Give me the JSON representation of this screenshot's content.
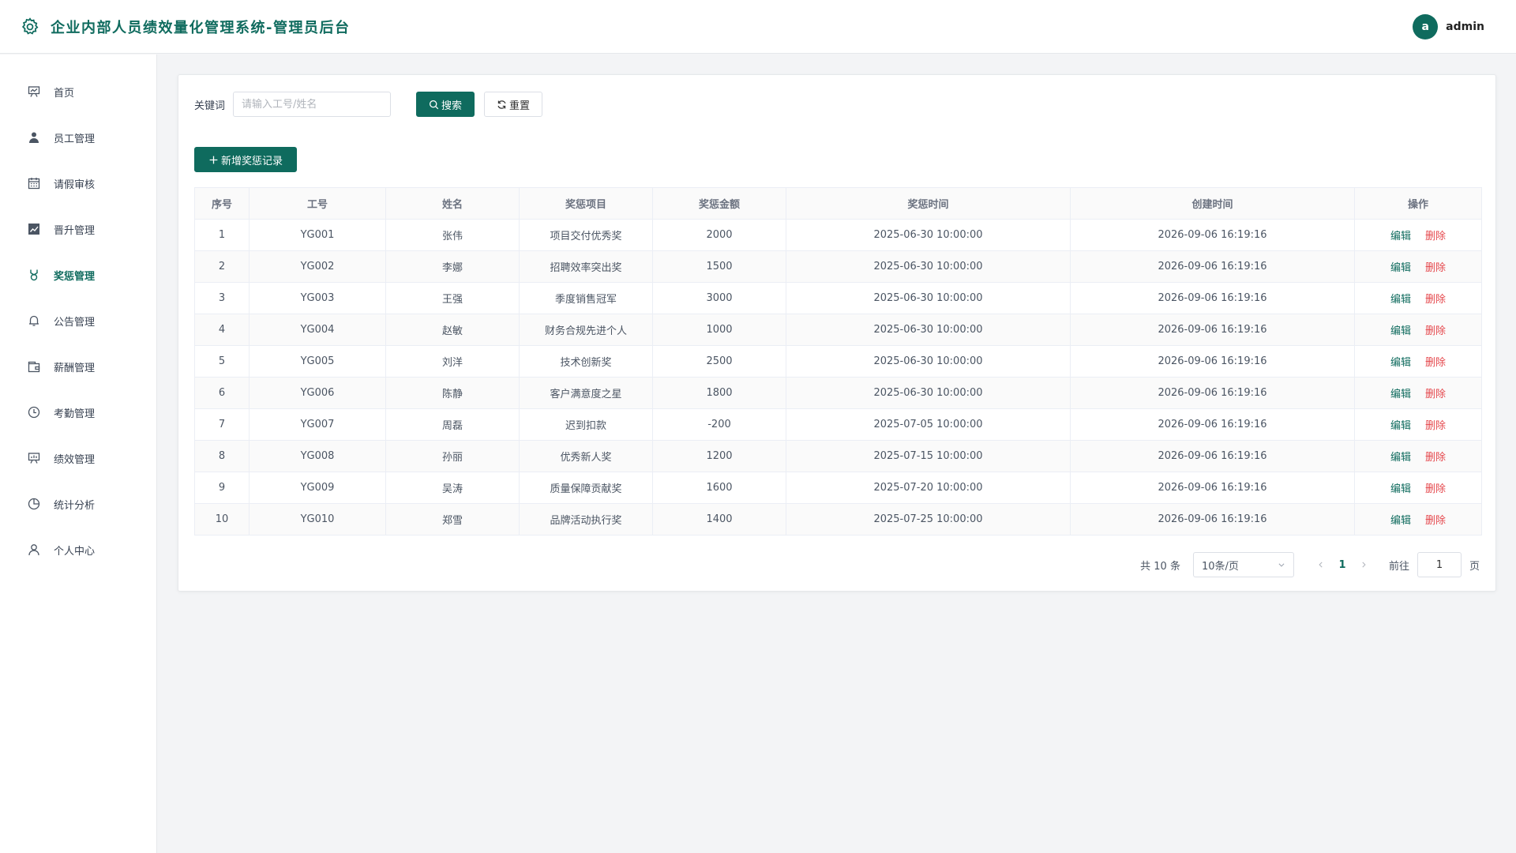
{
  "header": {
    "title": "企业内部人员绩效量化管理系统-管理员后台",
    "logo_icon": "gear-icon",
    "avatar_letter": "a",
    "username": "admin",
    "accent_color": "#0f6b5e"
  },
  "sidebar": {
    "items": [
      {
        "label": "首页",
        "icon": "presentation-icon",
        "active": false
      },
      {
        "label": "员工管理",
        "icon": "user-icon",
        "active": false
      },
      {
        "label": "请假审核",
        "icon": "calendar-icon",
        "active": false
      },
      {
        "label": "晋升管理",
        "icon": "trend-chart-icon",
        "active": false
      },
      {
        "label": "奖惩管理",
        "icon": "medal-icon",
        "active": true
      },
      {
        "label": "公告管理",
        "icon": "bell-icon",
        "active": false
      },
      {
        "label": "薪酬管理",
        "icon": "wallet-icon",
        "active": false
      },
      {
        "label": "考勤管理",
        "icon": "clock-icon",
        "active": false
      },
      {
        "label": "绩效管理",
        "icon": "data-board-icon",
        "active": false
      },
      {
        "label": "统计分析",
        "icon": "pie-chart-icon",
        "active": false
      },
      {
        "label": "个人中心",
        "icon": "user-outline-icon",
        "active": false
      }
    ]
  },
  "search": {
    "label": "关键词",
    "placeholder": "请输入工号/姓名",
    "value": "",
    "search_button": "搜索",
    "reset_button": "重置"
  },
  "toolbar": {
    "add_button": "新增奖惩记录"
  },
  "table": {
    "headers": [
      "序号",
      "工号",
      "姓名",
      "奖惩项目",
      "奖惩金额",
      "奖惩时间",
      "创建时间",
      "操作"
    ],
    "edit_label": "编辑",
    "delete_label": "删除",
    "rows": [
      [
        "1",
        "YG001",
        "张伟",
        "项目交付优秀奖",
        "2000",
        "2025-06-30 10:00:00",
        "2026-09-06 16:19:16"
      ],
      [
        "2",
        "YG002",
        "李娜",
        "招聘效率突出奖",
        "1500",
        "2025-06-30 10:00:00",
        "2026-09-06 16:19:16"
      ],
      [
        "3",
        "YG003",
        "王强",
        "季度销售冠军",
        "3000",
        "2025-06-30 10:00:00",
        "2026-09-06 16:19:16"
      ],
      [
        "4",
        "YG004",
        "赵敏",
        "财务合规先进个人",
        "1000",
        "2025-06-30 10:00:00",
        "2026-09-06 16:19:16"
      ],
      [
        "5",
        "YG005",
        "刘洋",
        "技术创新奖",
        "2500",
        "2025-06-30 10:00:00",
        "2026-09-06 16:19:16"
      ],
      [
        "6",
        "YG006",
        "陈静",
        "客户满意度之星",
        "1800",
        "2025-06-30 10:00:00",
        "2026-09-06 16:19:16"
      ],
      [
        "7",
        "YG007",
        "周磊",
        "迟到扣款",
        "-200",
        "2025-07-05 10:00:00",
        "2026-09-06 16:19:16"
      ],
      [
        "8",
        "YG008",
        "孙丽",
        "优秀新人奖",
        "1200",
        "2025-07-15 10:00:00",
        "2026-09-06 16:19:16"
      ],
      [
        "9",
        "YG009",
        "吴涛",
        "质量保障贡献奖",
        "1600",
        "2025-07-20 10:00:00",
        "2026-09-06 16:19:16"
      ],
      [
        "10",
        "YG010",
        "郑雪",
        "品牌活动执行奖",
        "1400",
        "2025-07-25 10:00:00",
        "2026-09-06 16:19:16"
      ]
    ]
  },
  "pagination": {
    "total_text": "共 10 条",
    "page_size": "10条/页",
    "current_page": "1",
    "goto_label": "前往",
    "goto_value": "1",
    "page_unit": "页"
  }
}
